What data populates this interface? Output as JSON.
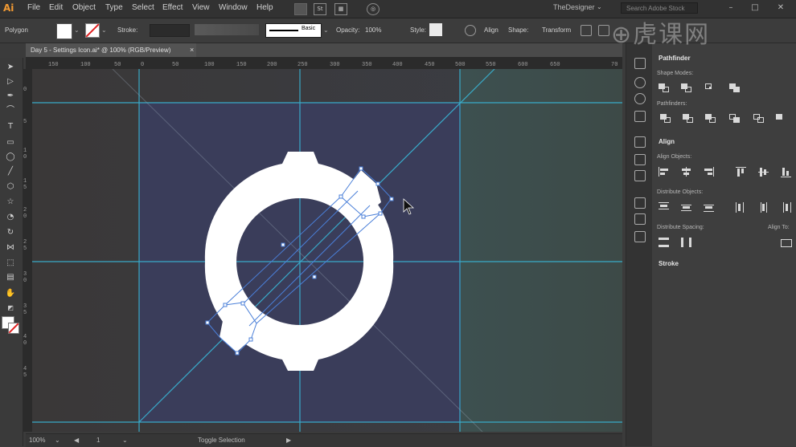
{
  "app": {
    "logo": "Ai",
    "workspace": "TheDesigner",
    "search_placeholder": "Search Adobe Stock"
  },
  "menu": [
    "File",
    "Edit",
    "Object",
    "Type",
    "Select",
    "Effect",
    "View",
    "Window",
    "Help"
  ],
  "menubar_icons": {
    "bridge": "St"
  },
  "control": {
    "tool_name": "Polygon",
    "stroke_label": "Stroke:",
    "brush_label": "Basic",
    "opacity_label": "Opacity:",
    "opacity_value": "100%",
    "style_label": "Style:",
    "align_label": "Align",
    "shape_label": "Shape:",
    "transform_label": "Transform"
  },
  "document": {
    "tab_title": "Day 5 - Settings Icon.ai* @ 100% (RGB/Preview)",
    "close": "×"
  },
  "rulers": {
    "horizontal": [
      "150",
      "100",
      "50",
      "0",
      "50",
      "100",
      "150",
      "200",
      "250",
      "300",
      "350",
      "400",
      "450",
      "500",
      "550",
      "600",
      "650",
      "70"
    ],
    "vertical": [
      "0",
      "5",
      "1",
      "0",
      "1",
      "5",
      "2",
      "0",
      "2",
      "5",
      "3",
      "0",
      "3",
      "5",
      "4",
      "0",
      "4",
      "5"
    ]
  },
  "status": {
    "zoom": "100%",
    "artboard": "1",
    "toggle_label": "Toggle Selection"
  },
  "panel": {
    "pathfinder": {
      "title": "Pathfinder",
      "shape_modes_label": "Shape Modes:",
      "pathfinders_label": "Pathfinders:"
    },
    "align": {
      "title": "Align",
      "align_objects_label": "Align Objects:",
      "distribute_objects_label": "Distribute Objects:",
      "distribute_spacing_label": "Distribute Spacing:",
      "align_to_label": "Align To:"
    },
    "stroke": {
      "title": "Stroke"
    }
  },
  "watermark": "虎课网",
  "colors": {
    "accent": "#f29a33",
    "guide": "#39b6d6",
    "artboard": "#3a3d5a",
    "selection": "#4a7fd8",
    "stroke_none": "#e02020"
  }
}
